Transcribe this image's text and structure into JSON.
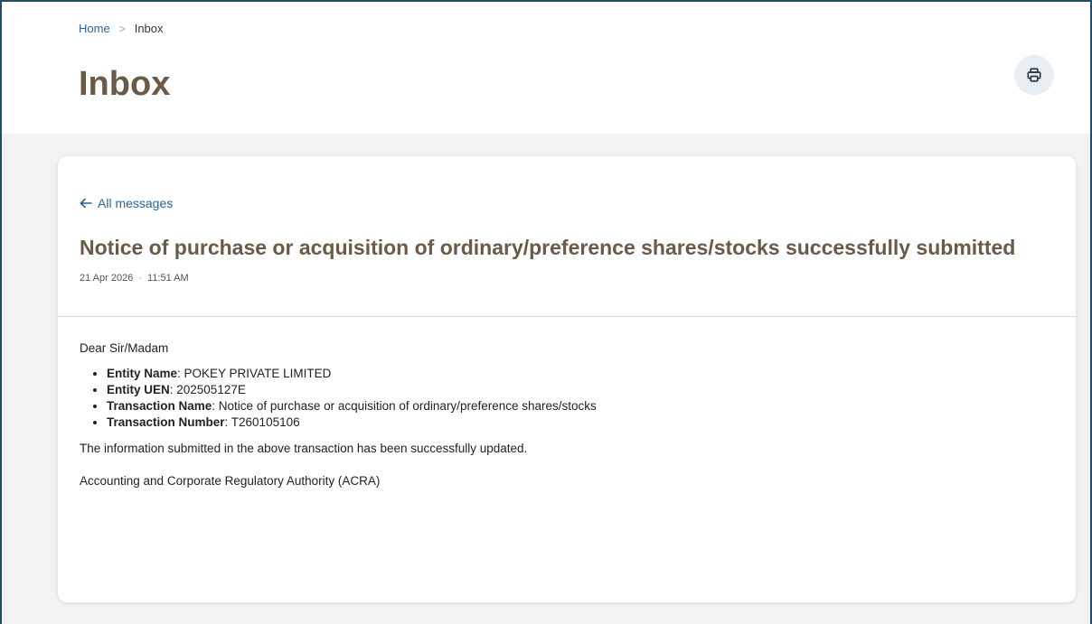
{
  "breadcrumb": {
    "home": "Home",
    "separator": ">",
    "current": "Inbox"
  },
  "page_title": "Inbox",
  "print_button": {
    "icon": "print-icon"
  },
  "message": {
    "back_label": "All messages",
    "title": "Notice of purchase or acquisition of ordinary/preference shares/stocks successfully submitted",
    "date": "21 Apr 2026",
    "meta_separator": "·",
    "time": "11:51 AM",
    "greeting": "Dear Sir/Madam",
    "details": [
      {
        "label": "Entity Name",
        "value": ": POKEY PRIVATE LIMITED"
      },
      {
        "label": "Entity UEN",
        "value": ": 202505127E"
      },
      {
        "label": "Transaction Name",
        "value": ": Notice of purchase or acquisition of ordinary/preference shares/stocks"
      },
      {
        "label": "Transaction Number",
        "value": ": T260105106"
      }
    ],
    "confirmation": "The information submitted in the above transaction has been successfully updated.",
    "signature": "Accounting and Corporate Regulatory Authority (ACRA)"
  },
  "colors": {
    "title_brown": "#6b5a48",
    "link_blue": "#2a6496",
    "page_bg": "#f2f2f2",
    "frame_border": "#1f4e66"
  }
}
